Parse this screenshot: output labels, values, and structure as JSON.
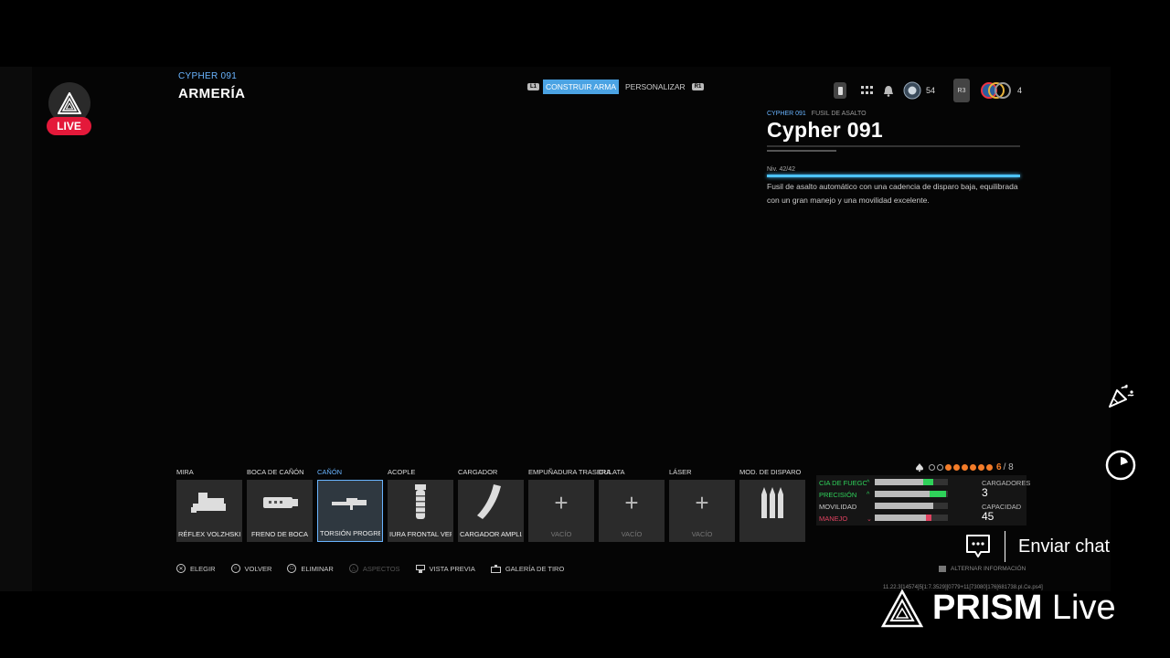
{
  "stream": {
    "live_label": "LIVE",
    "chat_label": "Enviar chat",
    "brand_bold": "PRISM",
    "brand_light": "Live"
  },
  "header": {
    "weapon_subtitle": "CYPHER 091",
    "title": "ARMERÍA",
    "tabs": [
      {
        "key": "L1",
        "label": "CONSTRUIR ARMA",
        "active": true
      },
      {
        "key": "R1",
        "label": "PERSONALIZAR",
        "active": false
      }
    ]
  },
  "hud": {
    "player_level": "54",
    "r3_key": "R3",
    "count": "4"
  },
  "weapon_info": {
    "meta_name": "CYPHER 091",
    "meta_type": "FUSIL DE ASALTO",
    "name": "Cypher 091",
    "level": "Niv. 42/42",
    "level_progress": 1.0,
    "description": "Fusil de asalto automático con una cadencia de disparo baja, equilibrada con un gran manejo y una movilidad excelente."
  },
  "slots": [
    {
      "category": "MIRA",
      "attachment": "RÉFLEX VOLZHSKIY",
      "icon": "sight-icon",
      "selected": false
    },
    {
      "category": "BOCA DE CAÑÓN",
      "attachment": "FRENO DE BOCA",
      "icon": "muzzle-icon",
      "selected": false
    },
    {
      "category": "CAÑÓN",
      "attachment": "TORSIÓN PROGRESIVA",
      "icon": "barrel-icon",
      "selected": true
    },
    {
      "category": "ACOPLE",
      "attachment": "IURA FRONTAL VERTICAL",
      "icon": "grip-icon",
      "selected": false
    },
    {
      "category": "CARGADOR",
      "attachment": "CARGADOR AMPLIADO I",
      "icon": "magazine-icon",
      "selected": false
    },
    {
      "category": "EMPUÑADURA TRASERA",
      "attachment": "VACÍO",
      "icon": "plus-icon",
      "selected": false
    },
    {
      "category": "CULATA",
      "attachment": "VACÍO",
      "icon": "plus-icon",
      "selected": false
    },
    {
      "category": "LÁSER",
      "attachment": "VACÍO",
      "icon": "plus-icon",
      "selected": false
    },
    {
      "category": "MOD. DE DISPARO",
      "attachment": "",
      "icon": "ammo-icon",
      "selected": false
    }
  ],
  "attachment_count": {
    "used": "6",
    "total": "/ 8",
    "filled": 6,
    "max": 8
  },
  "stats": [
    {
      "name": "CIA DE FUEGO",
      "base": 0.66,
      "extra": 0.14,
      "neg": 0,
      "color": "#2fd25a"
    },
    {
      "name": "PRECISIÓN",
      "base": 0.75,
      "extra": 0.23,
      "neg": 0,
      "color": "#2fd25a"
    },
    {
      "name": "MOVILIDAD",
      "base": 0.8,
      "extra": 0,
      "neg": 0,
      "color": "#cccccc"
    },
    {
      "name": "MANEJO",
      "base": 0.78,
      "extra": 0,
      "neg": 0.08,
      "color": "#e04260"
    }
  ],
  "magazines": {
    "label": "CARGADORES",
    "value": "3"
  },
  "capacity": {
    "label": "CAPACIDAD",
    "value": "45"
  },
  "footer": [
    {
      "icon": "cross-button-icon",
      "label": "ELEGIR",
      "dim": false
    },
    {
      "icon": "circle-button-icon",
      "label": "VOLVER",
      "dim": false
    },
    {
      "icon": "square-button-icon",
      "label": "ELIMINAR",
      "dim": false
    },
    {
      "icon": "triangle-button-icon",
      "label": "ASPECTOS",
      "dim": true
    },
    {
      "icon": "preview-icon",
      "label": "VISTA PREVIA",
      "dim": false
    },
    {
      "icon": "gallery-icon",
      "label": "GALERÍA DE TIRO",
      "dim": false
    }
  ],
  "alt_info": "ALTERNAR INFORMACIÓN",
  "build_id": "11.22.3[14574]5[1:7.3529][0779+11[73080]176[681738.pl.Ce.ps4]"
}
